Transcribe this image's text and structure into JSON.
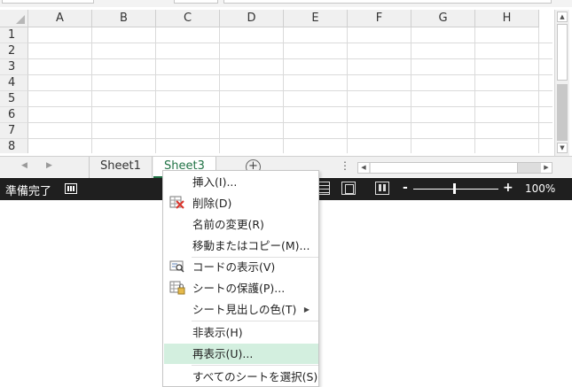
{
  "grid": {
    "columns": [
      "A",
      "B",
      "C",
      "D",
      "E",
      "F",
      "G",
      "H"
    ],
    "rows": [
      "1",
      "2",
      "3",
      "4",
      "5",
      "6",
      "7",
      "8"
    ]
  },
  "sheets": {
    "tabs": [
      "Sheet1",
      "Sheet3"
    ],
    "active": "Sheet3",
    "add_symbol": "+"
  },
  "status": {
    "ready": "準備完了",
    "zoom_minus": "-",
    "zoom_plus": "+",
    "zoom": "100%"
  },
  "context_menu": {
    "items": [
      {
        "label": "挿入(I)...",
        "icon": null
      },
      {
        "label": "削除(D)",
        "icon": "delete-sheet-icon"
      },
      {
        "label": "名前の変更(R)",
        "icon": null
      },
      {
        "label": "移動またはコピー(M)...",
        "icon": null
      },
      {
        "label": "コードの表示(V)",
        "icon": "view-code-icon"
      },
      {
        "label": "シートの保護(P)...",
        "icon": "protect-sheet-icon"
      },
      {
        "label": "シート見出しの色(T)",
        "icon": null,
        "submenu": true
      },
      {
        "label": "非表示(H)",
        "icon": null
      },
      {
        "label": "再表示(U)...",
        "icon": null,
        "highlighted": true
      },
      {
        "label": "すべてのシートを選択(S)",
        "icon": null
      }
    ]
  },
  "colors": {
    "accent": "#217346",
    "highlight": "#d3efdf",
    "statusbar": "#1f1f1f"
  }
}
